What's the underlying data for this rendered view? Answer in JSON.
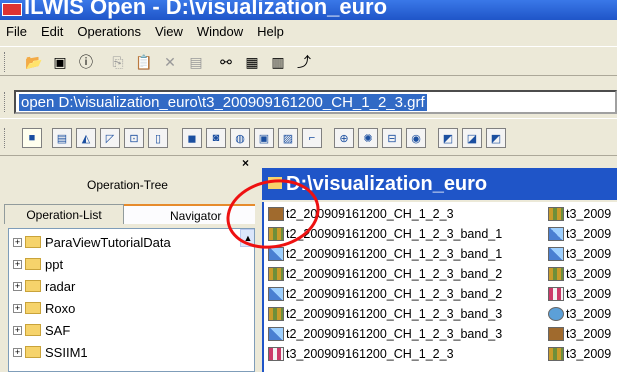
{
  "window": {
    "title": "ILWIS Open - D:\\visualization_euro"
  },
  "menu": [
    "File",
    "Edit",
    "Operations",
    "View",
    "Window",
    "Help"
  ],
  "command_line": {
    "value": "open D:\\visualization_euro\\t3_200909161200_CH_1_2_3.grf"
  },
  "left_panel": {
    "close": "×",
    "title": "Operation-Tree",
    "tabs": [
      "Operation-List",
      "Navigator"
    ],
    "tree": [
      "ParaViewTutorialData",
      "ppt",
      "radar",
      "Roxo",
      "SAF",
      "SSIIM1"
    ]
  },
  "right_panel": {
    "title": "D:\\visualization_euro",
    "files_col1": [
      "t2_200909161200_CH_1_2_3",
      "t2_200909161200_CH_1_2_3_band_1",
      "t2_200909161200_CH_1_2_3_band_1",
      "t2_200909161200_CH_1_2_3_band_2",
      "t2_200909161200_CH_1_2_3_band_2",
      "t2_200909161200_CH_1_2_3_band_3",
      "t2_200909161200_CH_1_2_3_band_3",
      "t3_200909161200_CH_1_2_3"
    ],
    "files_col2": [
      "t3_2009",
      "t3_2009",
      "t3_2009",
      "t3_2009",
      "t3_2009",
      "t3_2009",
      "t3_2009",
      "t3_2009"
    ]
  },
  "icons": {
    "annotation_color": "#e11111"
  }
}
